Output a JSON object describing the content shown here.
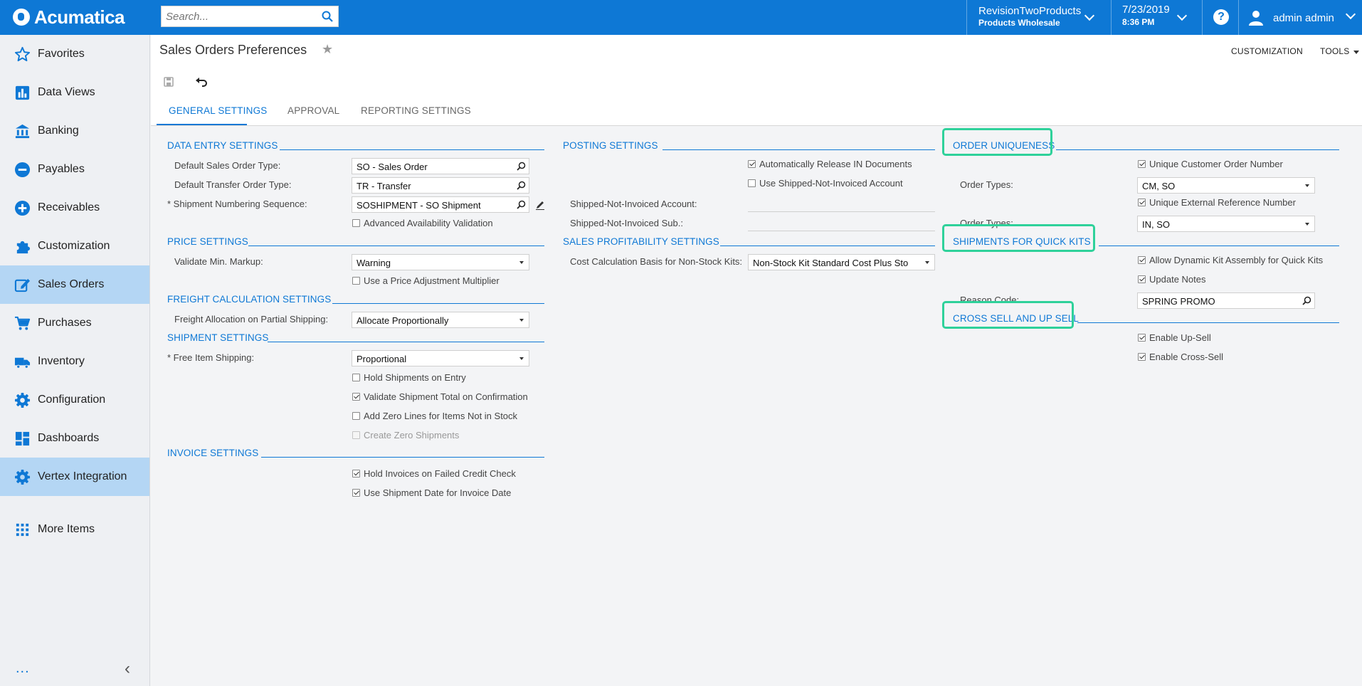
{
  "app": {
    "brand": "Acumatica",
    "search_placeholder": "Search...",
    "tenant": {
      "name": "RevisionTwoProducts",
      "branch": "Products Wholesale"
    },
    "date": "7/23/2019",
    "time": "8:36 PM",
    "help": "?",
    "user": "admin admin",
    "brand_color": "#0e78d5",
    "highlight_color": "#2ed19a"
  },
  "sidebar": {
    "items": [
      {
        "label": "Favorites",
        "icon": "star-icon"
      },
      {
        "label": "Data Views",
        "icon": "bar-chart-icon"
      },
      {
        "label": "Banking",
        "icon": "bank-icon"
      },
      {
        "label": "Payables",
        "icon": "minus-circle-icon"
      },
      {
        "label": "Receivables",
        "icon": "plus-circle-icon"
      },
      {
        "label": "Customization",
        "icon": "puzzle-icon"
      },
      {
        "label": "Sales Orders",
        "icon": "pencil-square-icon",
        "active": true
      },
      {
        "label": "Purchases",
        "icon": "cart-icon"
      },
      {
        "label": "Inventory",
        "icon": "truck-icon"
      },
      {
        "label": "Configuration",
        "icon": "gear-icon"
      },
      {
        "label": "Dashboards",
        "icon": "dashboard-icon"
      },
      {
        "label": "Vertex Integration",
        "icon": "gear-icon",
        "active": true
      },
      {
        "label": "More Items",
        "icon": "grid-icon"
      }
    ],
    "footer_dots": "...",
    "collapse": "‹"
  },
  "page": {
    "title": "Sales Orders Preferences",
    "customization": "CUSTOMIZATION",
    "tools": "TOOLS",
    "tabs": [
      "GENERAL SETTINGS",
      "APPROVAL",
      "REPORTING SETTINGS"
    ],
    "active_tab": 0
  },
  "col1": {
    "data_entry": {
      "title": "DATA ENTRY SETTINGS",
      "default_so_type_label": "Default Sales Order Type:",
      "default_so_type": "SO - Sales Order",
      "default_transfer_label": "Default Transfer Order Type:",
      "default_transfer": "TR - Transfer",
      "shipment_seq_label": "* Shipment Numbering Sequence:",
      "shipment_seq": "SOSHIPMENT - SO Shipment",
      "adv_avail": "Advanced Availability Validation"
    },
    "price": {
      "title": "PRICE SETTINGS",
      "min_markup_label": "Validate Min. Markup:",
      "min_markup": "Warning",
      "price_adj": "Use a Price Adjustment Multiplier"
    },
    "freight": {
      "title": "FREIGHT CALCULATION SETTINGS",
      "alloc_label": "Freight Allocation on Partial Shipping:",
      "alloc": "Allocate Proportionally"
    },
    "shipment": {
      "title": "SHIPMENT SETTINGS",
      "free_item_label": "* Free Item Shipping:",
      "free_item": "Proportional",
      "hold_on_entry": "Hold Shipments on Entry",
      "validate_total": "Validate Shipment Total on Confirmation",
      "zero_lines": "Add Zero Lines for Items Not in Stock",
      "zero_shipments": "Create Zero Shipments"
    },
    "invoice": {
      "title": "INVOICE SETTINGS",
      "hold_failed_credit": "Hold Invoices on Failed Credit Check",
      "use_ship_date": "Use Shipment Date for Invoice Date"
    }
  },
  "col2": {
    "posting": {
      "title": "POSTING SETTINGS",
      "auto_release": "Automatically Release IN Documents",
      "use_sni": "Use Shipped-Not-Invoiced Account",
      "sni_account_label": "Shipped-Not-Invoiced Account:",
      "sni_sub_label": "Shipped-Not-Invoiced Sub.:"
    },
    "profitability": {
      "title": "SALES PROFITABILITY SETTINGS",
      "cost_basis_label": "Cost Calculation Basis for Non-Stock Kits:",
      "cost_basis": "Non-Stock Kit Standard Cost Plus Sto"
    }
  },
  "col3": {
    "uniqueness": {
      "title": "ORDER UNIQUENESS",
      "unique_customer": "Unique Customer Order Number",
      "order_types_label": "Order Types:",
      "order_types_1": "CM, SO",
      "unique_external": "Unique External Reference Number",
      "order_types_label_2": "Order Types:",
      "order_types_2": "IN, SO"
    },
    "quick_kits": {
      "title": "SHIPMENTS FOR QUICK KITS",
      "dynamic_kit": "Allow Dynamic Kit Assembly for Quick Kits",
      "update_notes": "Update Notes",
      "reason_code_label": "Reason Code:",
      "reason_code": "SPRING PROMO"
    },
    "cross_sell": {
      "title": "CROSS SELL AND UP SELL",
      "enable_upsell": "Enable Up-Sell",
      "enable_crosssell": "Enable Cross-Sell"
    }
  }
}
